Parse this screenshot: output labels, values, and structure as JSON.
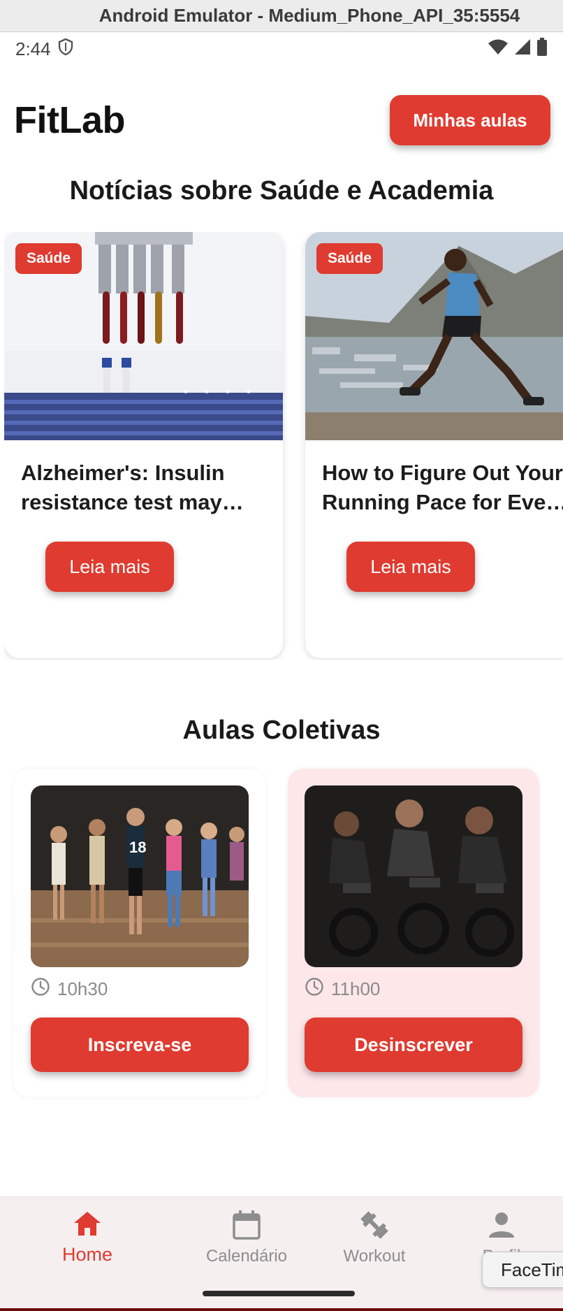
{
  "window": {
    "title": "Android Emulator - Medium_Phone_API_35:5554"
  },
  "status_bar": {
    "time": "2:44"
  },
  "header": {
    "title": "FitLab",
    "my_classes_label": "Minhas aulas"
  },
  "news": {
    "section_title": "Notícias sobre Saúde e Academia",
    "items": [
      {
        "badge": "Saúde",
        "headline": "Alzheimer's: Insulin resistance test may predict risk",
        "read_more_label": "Leia mais",
        "image_icon": "lab-tubes-image"
      },
      {
        "badge": "Saúde",
        "headline": "How to Figure Out Your Running Pace for Every Run",
        "read_more_label": "Leia mais",
        "image_icon": "runner-image"
      }
    ]
  },
  "classes": {
    "section_title": "Aulas Coletivas",
    "items": [
      {
        "time": "10h30",
        "button_label": "Inscreva-se",
        "subscribed": false,
        "image_icon": "dance-class-image"
      },
      {
        "time": "11h00",
        "button_label": "Desinscrever",
        "subscribed": true,
        "image_icon": "spinning-class-image"
      }
    ]
  },
  "bottom_nav": {
    "items": [
      {
        "label": "Home",
        "icon": "home-icon",
        "active": true
      },
      {
        "label": "Calendário",
        "icon": "calendar-icon",
        "active": false
      },
      {
        "label": "Workout",
        "icon": "dumbbell-icon",
        "active": false
      },
      {
        "label": "Perfil",
        "icon": "person-icon",
        "active": false
      }
    ]
  },
  "tooltip": {
    "text": "FaceTime"
  },
  "colors": {
    "accent": "#df3b30",
    "subscribed_card_bg": "#fde7e9",
    "nav_bg": "#f6eff0"
  }
}
